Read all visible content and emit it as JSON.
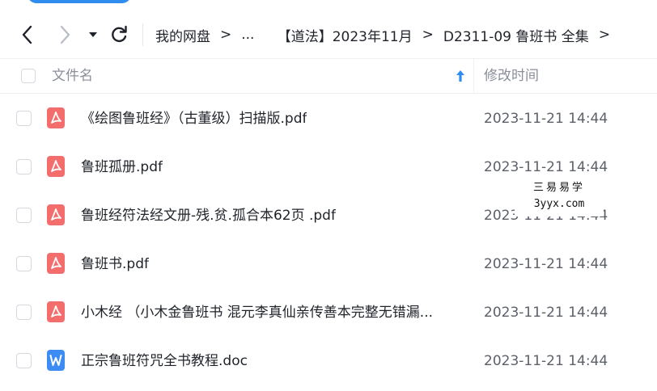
{
  "nav": {
    "back_icon": "chevron-left-icon",
    "forward_icon": "chevron-right-icon",
    "dropdown_icon": "caret-down-icon",
    "refresh_icon": "refresh-icon"
  },
  "breadcrumb": {
    "items": [
      "我的网盘",
      "...",
      "【道法】2023年11月",
      "D2311-09 鲁班书 全集"
    ],
    "separator": ">"
  },
  "table": {
    "header_name": "文件名",
    "header_time": "修改时间",
    "sort_icon": "arrow-up-icon"
  },
  "files": [
    {
      "name": "《绘图鲁班经》（古董级）扫描版.pdf",
      "time": "2023-11-21 14:44",
      "type": "pdf"
    },
    {
      "name": "鲁班孤册.pdf",
      "time": "2023-11-21 14:44",
      "type": "pdf"
    },
    {
      "name": "鲁班经符法经文册-残.贫.孤合本62页 .pdf",
      "time": "2023-11-21 14:44",
      "type": "pdf"
    },
    {
      "name": "鲁班书.pdf",
      "time": "2023-11-21 14:44",
      "type": "pdf"
    },
    {
      "name": "小木经 （小木金鲁班书 混元李真仙亲传善本完整无错漏...",
      "time": "2023-11-21 14:44",
      "type": "pdf"
    },
    {
      "name": "正宗鲁班符咒全书教程.doc",
      "time": "2023-11-21 14:44",
      "type": "doc"
    }
  ],
  "watermark": {
    "line1": "三易易学",
    "line2": "3yyx.com"
  },
  "colors": {
    "pdf_icon": "#f46d6d",
    "doc_icon": "#3c8cf4",
    "accent": "#2f8df0"
  }
}
